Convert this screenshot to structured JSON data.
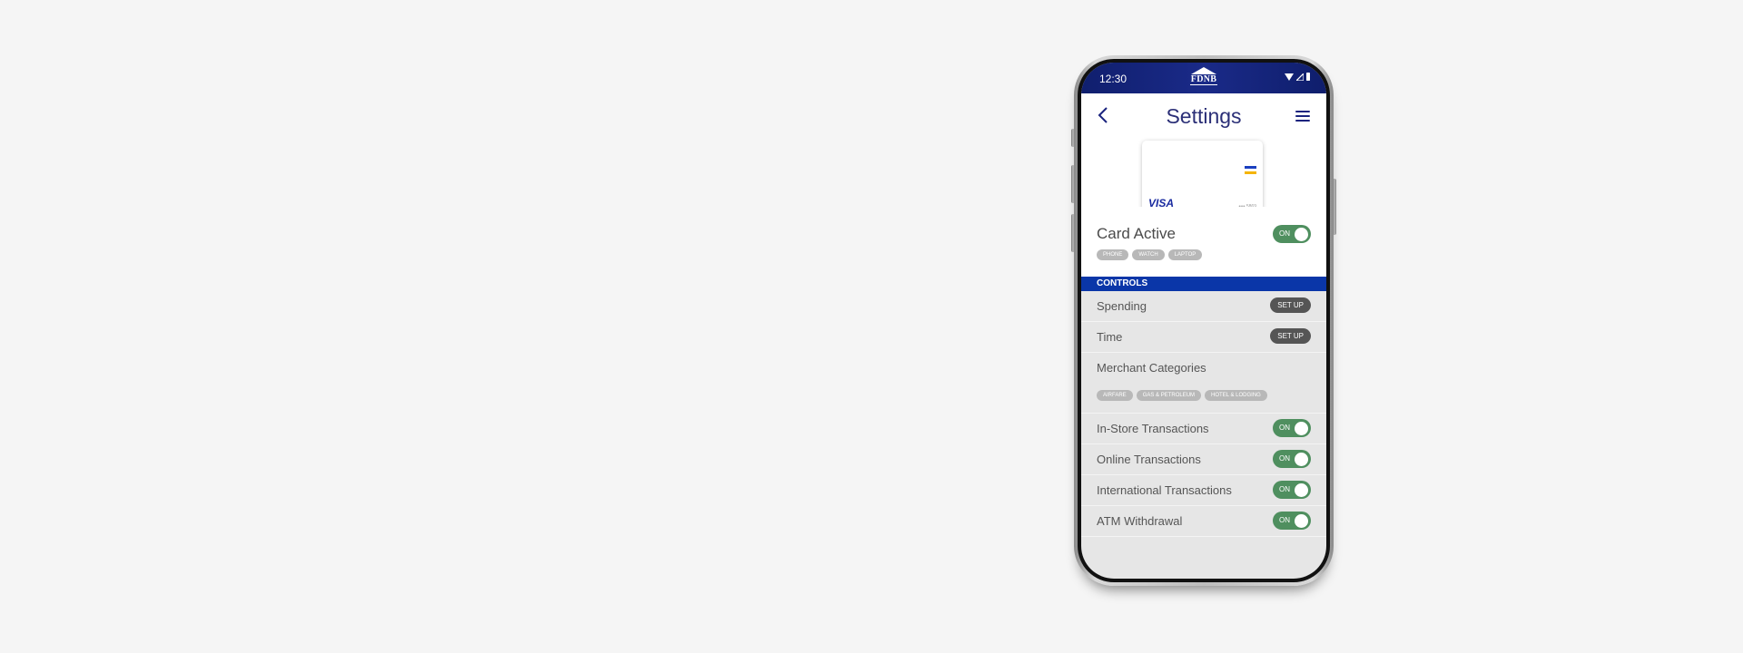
{
  "status_bar": {
    "time": "12:30",
    "logo": "FDNB",
    "icons": [
      "wifi-icon",
      "signal-icon",
      "battery-icon"
    ]
  },
  "header": {
    "back_icon": "chevron-left-icon",
    "title": "Settings",
    "menu_icon": "hamburger-menu-icon"
  },
  "card": {
    "brand": "VISA",
    "number_masked": "•••• 5869",
    "stripe_colors": [
      "#1a3fbf",
      "#f5b400"
    ]
  },
  "card_active": {
    "label": "Card Active",
    "toggle": "ON",
    "devices": [
      "PHONE",
      "WATCH",
      "LAPTOP"
    ]
  },
  "controls": {
    "header": "CONTROLS",
    "spending": {
      "label": "Spending",
      "button": "SET UP"
    },
    "time": {
      "label": "Time",
      "button": "SET UP"
    },
    "merchant": {
      "label": "Merchant Categories",
      "categories": [
        "AIRFARE",
        "GAS & PETROLEUM",
        "HOTEL & LODGING"
      ]
    },
    "toggles": [
      {
        "label": "In-Store Transactions",
        "state": "ON"
      },
      {
        "label": "Online Transactions",
        "state": "ON"
      },
      {
        "label": "International Transactions",
        "state": "ON"
      },
      {
        "label": "ATM Withdrawal",
        "state": "ON"
      }
    ]
  },
  "colors": {
    "brand_navy": "#1a237e",
    "section_blue": "#0a36a8",
    "toggle_green": "#4f8f5f"
  }
}
